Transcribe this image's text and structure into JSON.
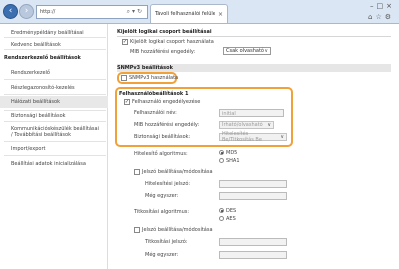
{
  "browser": {
    "url": "http://",
    "tab_title": "Távoli felhasználói felület ...",
    "back_icon": "back-arrow-icon",
    "forward_icon": "forward-arrow-icon"
  },
  "sidebar": {
    "items_top": [
      "Eredménypéldány beállításai",
      "Kedvenc beállítások"
    ],
    "section_header": "Rendszerkezelő beállítások",
    "items": [
      "Rendszerkezelő",
      "Részlegazonosító-kezelés",
      "Hálózati beállítások",
      "Biztonsági beállítások",
      "Kommunikációskészülék beállításai / Továbbítási beállítások",
      "Import/export",
      "Beállítási adatok inicializálása"
    ]
  },
  "main": {
    "dedicated_section": "Kijelölt logikai csoport beállításai",
    "use_dedicated_label": "Kijelölt logikai csoport használata",
    "mib_access_label": "MIB hozzáférési engedély:",
    "mib_access_value": "Csak olvasható",
    "snmpv3_header": "SNMPv3 beállítások",
    "use_snmpv3_label": "SNMPv3 használata",
    "user_settings_header": "Felhasználóbeállítások 1",
    "enable_user_label": "Felhasználó engedélyezése",
    "user_name_label": "Felhasználói név:",
    "user_name_value": "initial",
    "mib_perm_label": "MIB hozzáférési engedély:",
    "mib_perm_value": "Írható/olvasható",
    "security_label": "Biztonsági beállítások:",
    "security_value": "Hitelesítés Be/Titkosítás Be",
    "auth_alg_label": "Hitelesítő algoritmus:",
    "auth_opt1": "MD5",
    "auth_opt2": "SHA1",
    "set_auth_pw_label": "Jelszó beállítása/módosítása",
    "auth_pw_label": "Hitelesítési jelszó:",
    "auth_confirm_label": "Még egyszer:",
    "enc_alg_label": "Titkosítási algoritmus:",
    "enc_opt1": "DES",
    "enc_opt2": "AES",
    "set_enc_pw_label": "Jelszó beállítása/módosítása",
    "enc_pw_label": "Titkosítási jelszó:",
    "enc_confirm_label": "Még egyszer:"
  },
  "colors": {
    "highlight": "#f0a13a",
    "chrome_bg": "#dbe6f4",
    "accent": "#3c6fb0"
  }
}
